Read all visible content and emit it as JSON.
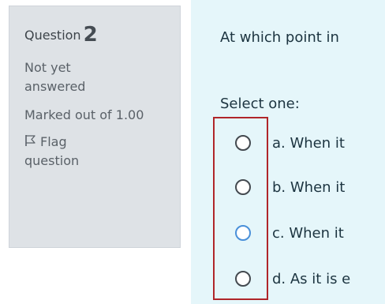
{
  "info": {
    "question_label": "Question",
    "question_number": "2",
    "state": "Not yet answered",
    "grade": "Marked out of 1.00",
    "flag_label": "Flag question"
  },
  "content": {
    "question_text": "At which point in",
    "prompt": "Select one:",
    "answers": [
      {
        "label": "a. When it"
      },
      {
        "label": "b. When it"
      },
      {
        "label": "c. When it"
      },
      {
        "label": "d. As it is e"
      }
    ]
  },
  "colors": {
    "info_bg": "#dee2e6",
    "content_bg": "#e5f6fa",
    "highlight_border": "#b0262a",
    "focus_radio": "#4a90d9"
  }
}
